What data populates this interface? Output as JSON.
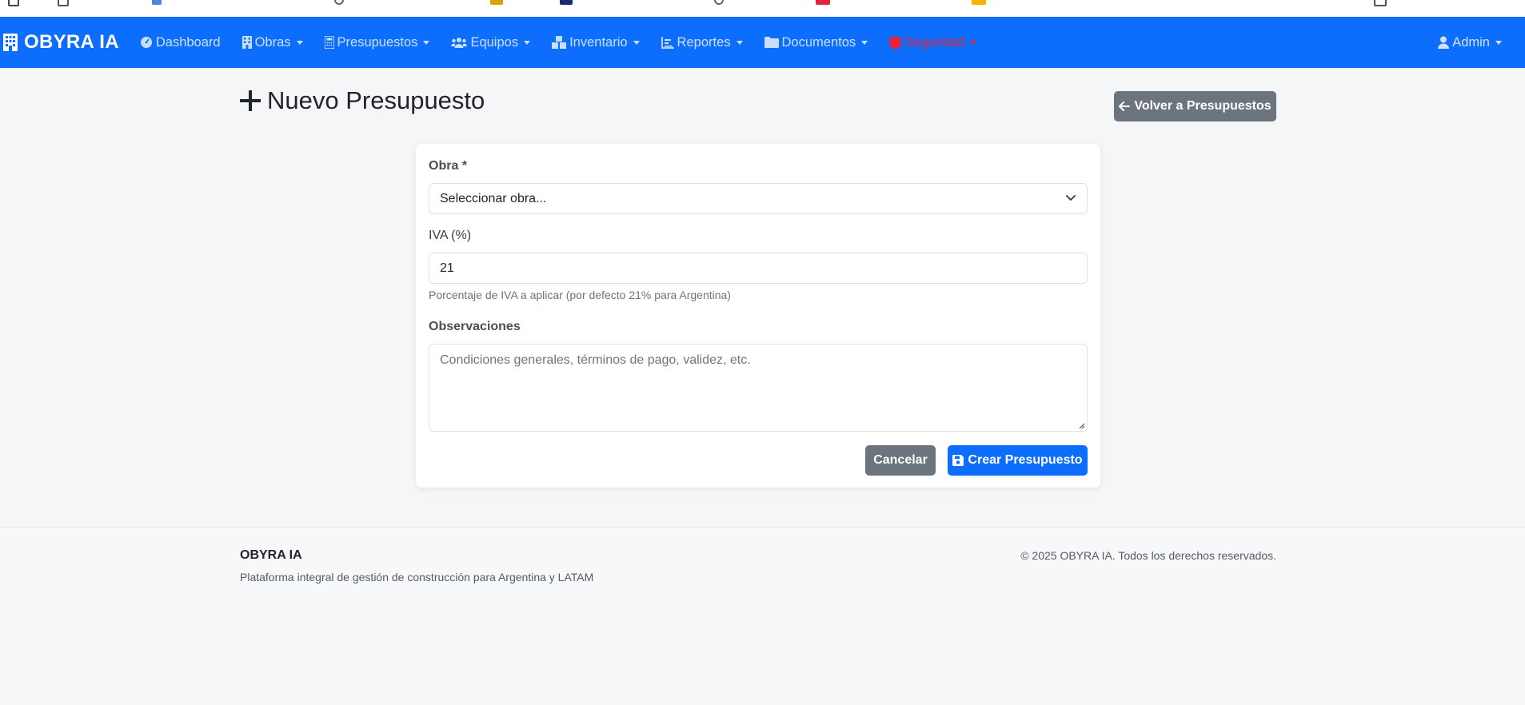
{
  "navbar": {
    "brand": "OBYRA IA",
    "items": [
      {
        "label": "Dashboard",
        "icon": "dashboard-icon",
        "dropdown": false
      },
      {
        "label": "Obras",
        "icon": "building-icon",
        "dropdown": true
      },
      {
        "label": "Presupuestos",
        "icon": "calculator-icon",
        "dropdown": true
      },
      {
        "label": "Equipos",
        "icon": "users-icon",
        "dropdown": true
      },
      {
        "label": "Inventario",
        "icon": "boxes-icon",
        "dropdown": true
      },
      {
        "label": "Reportes",
        "icon": "chart-icon",
        "dropdown": true
      },
      {
        "label": "Documentos",
        "icon": "folder-icon",
        "dropdown": true
      },
      {
        "label": "Seguridad",
        "icon": "shield-icon",
        "dropdown": true
      }
    ],
    "user": {
      "label": "Admin",
      "icon": "user-icon"
    }
  },
  "header": {
    "title": "Nuevo Presupuesto",
    "back_button": "Volver a Presupuestos"
  },
  "form": {
    "obra": {
      "label": "Obra *",
      "value": "Seleccionar obra..."
    },
    "iva": {
      "label": "IVA (%)",
      "value": "21",
      "help": "Porcentaje de IVA a aplicar (por defecto 21% para Argentina)"
    },
    "observaciones": {
      "label": "Observaciones",
      "placeholder": "Condiciones generales, términos de pago, validez, etc."
    },
    "cancel_label": "Cancelar",
    "submit_label": "Crear Presupuesto"
  },
  "footer": {
    "brand": "OBYRA IA",
    "tagline": "Plataforma integral de gestión de construcción para Argentina y LATAM",
    "copyright": "© 2025 OBYRA IA. Todos los derechos reservados."
  },
  "colors": {
    "primary": "#0d6efd",
    "secondary": "#6c757d",
    "danger": "#e8233b",
    "background": "#f5f6f8"
  }
}
